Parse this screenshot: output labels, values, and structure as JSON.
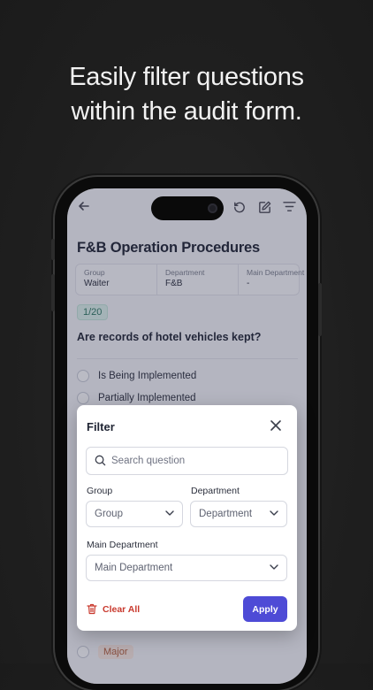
{
  "headline": {
    "line1": "Easily filter questions",
    "line2": "within the audit form."
  },
  "form": {
    "title": "F&B Operation Procedures",
    "meta": [
      {
        "key": "Group",
        "value": "Waiter"
      },
      {
        "key": "Department",
        "value": "F&B"
      },
      {
        "key": "Main Department",
        "value": "-"
      }
    ],
    "progress": "1/20",
    "question": "Are records of hotel vehicles kept?",
    "options": [
      "Is Being Implemented",
      "Partially Implemented"
    ],
    "severity_tag": "Major"
  },
  "icons": {
    "back": "arrow-left-icon",
    "undo": "undo-icon",
    "note": "note-edit-icon",
    "filter": "filter-lines-icon"
  },
  "filter_modal": {
    "title": "Filter",
    "search_placeholder": "Search question",
    "group_label": "Group",
    "group_value": "Group",
    "department_label": "Department",
    "department_value": "Department",
    "main_department_label": "Main Department",
    "main_department_value": "Main Department",
    "clear_label": "Clear All",
    "apply_label": "Apply"
  },
  "colors": {
    "accent": "#4e4bd6",
    "danger": "#c93a2e",
    "progress_bg": "#dff3ec",
    "progress_text": "#2f7a62"
  }
}
